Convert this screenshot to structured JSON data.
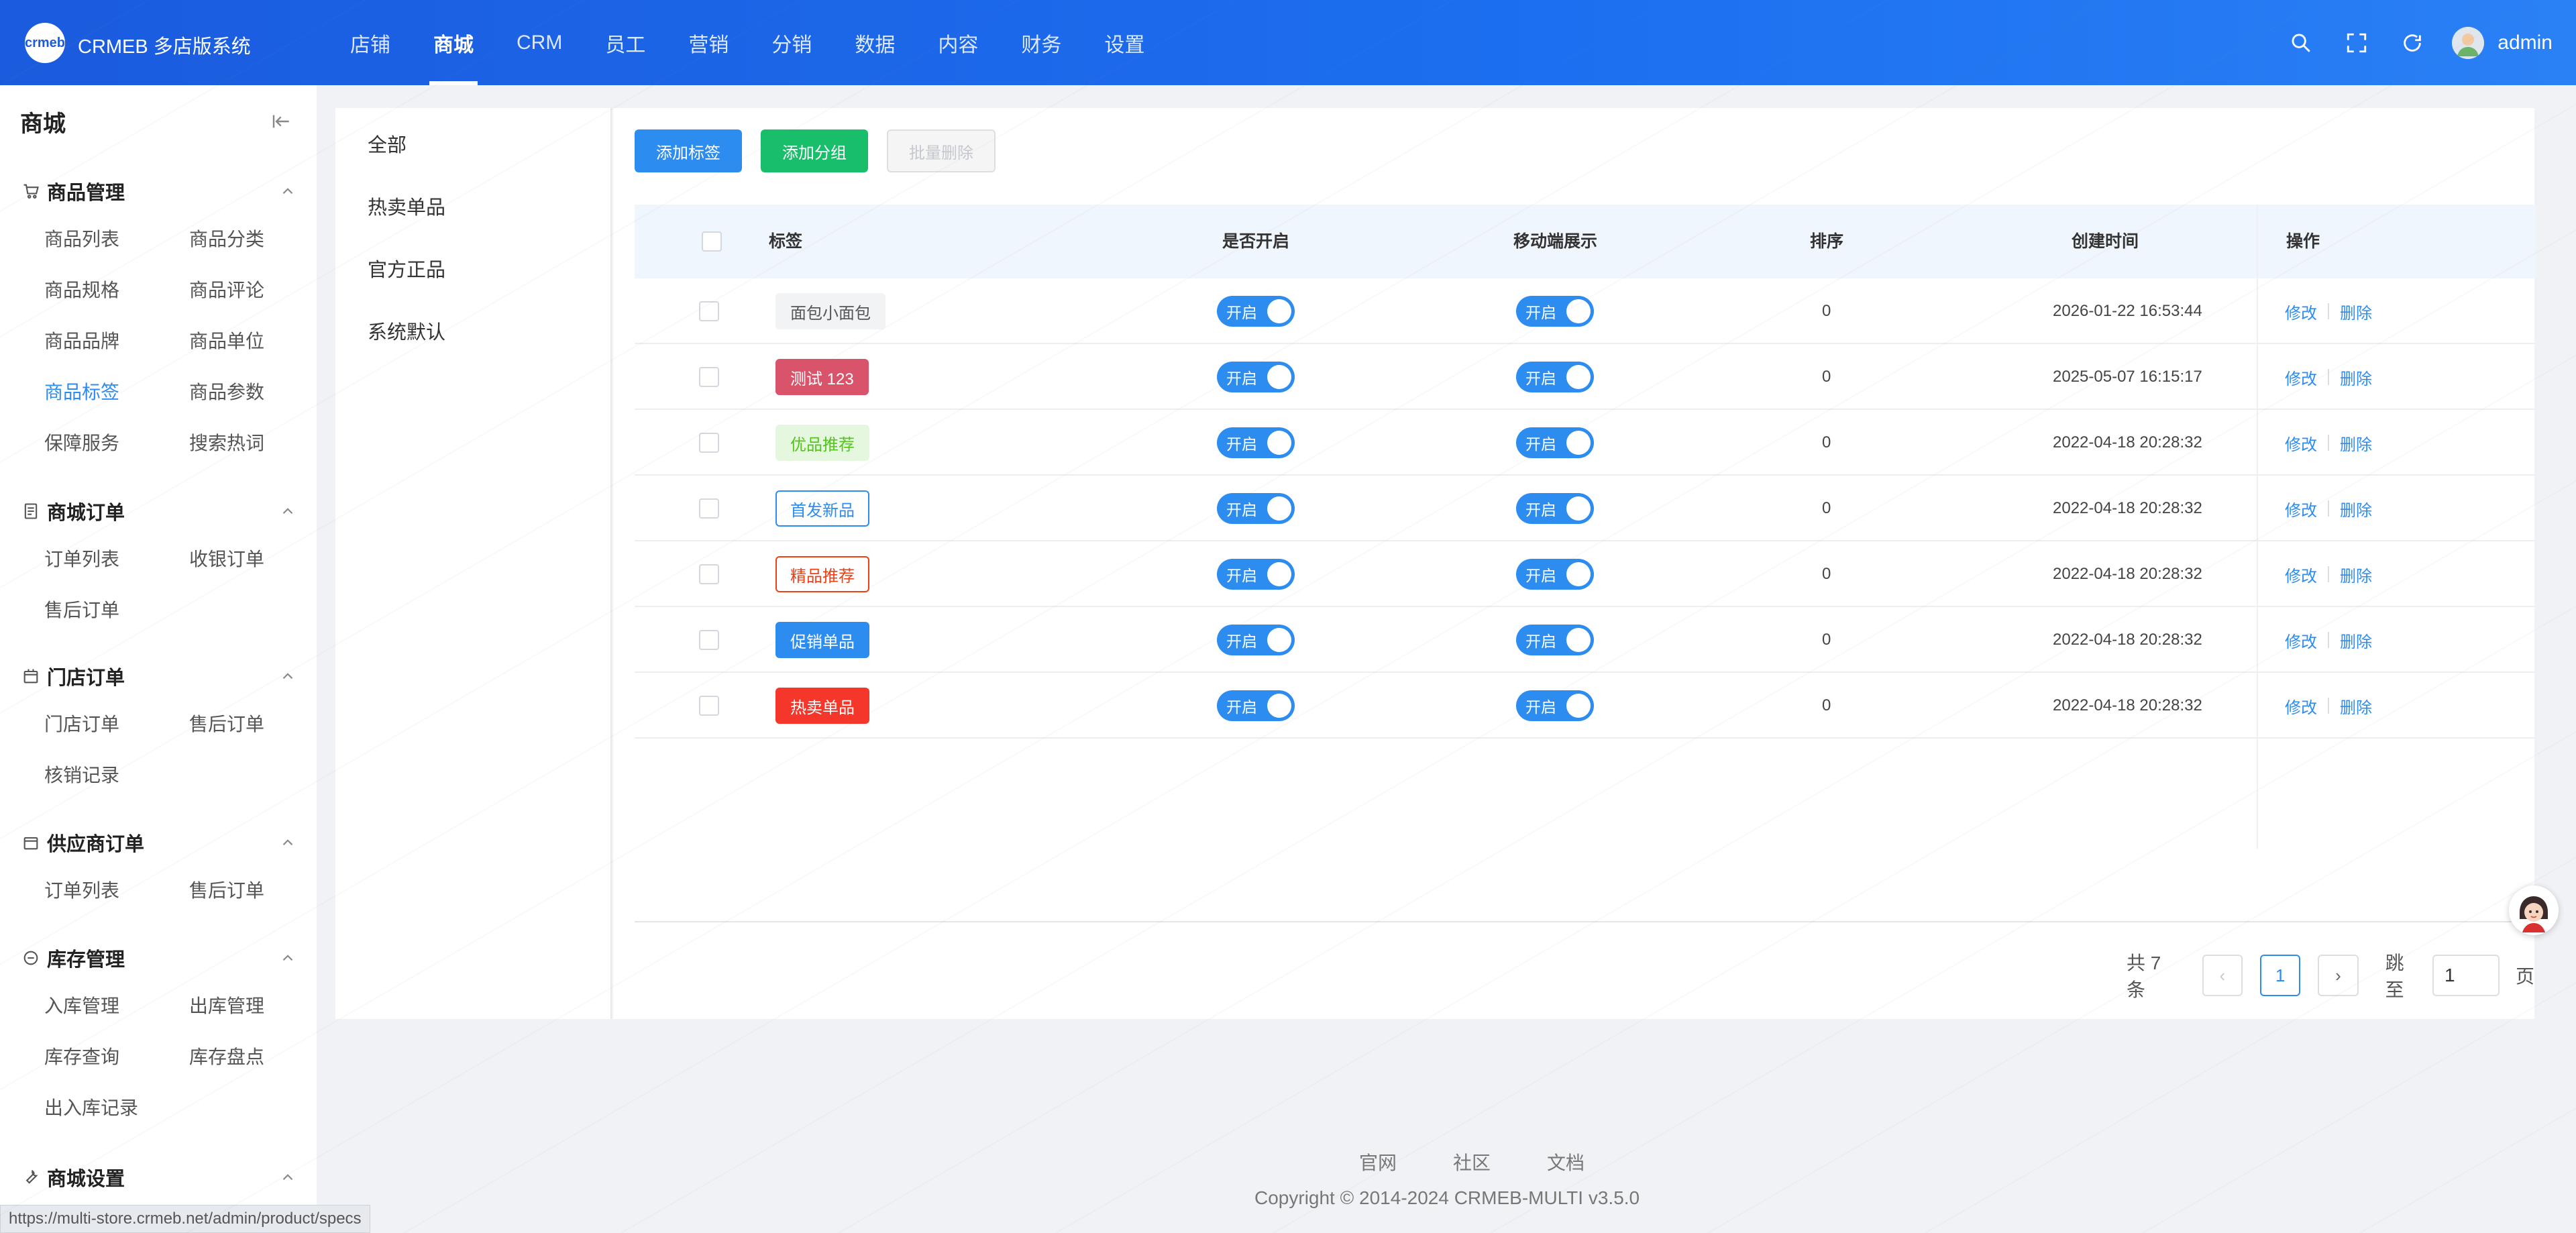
{
  "header": {
    "logo_text": "crmeb",
    "brand": "CRMEB 多店版系统",
    "nav": [
      "店铺",
      "商城",
      "CRM",
      "员工",
      "营销",
      "分销",
      "数据",
      "内容",
      "财务",
      "设置"
    ],
    "active_nav": "商城",
    "user": "admin"
  },
  "sidebar": {
    "title": "商城",
    "groups": [
      {
        "label": "商品管理",
        "icon": "cart-icon",
        "items": [
          "商品列表",
          "商品分类",
          "商品规格",
          "商品评论",
          "商品品牌",
          "商品单位",
          "商品标签",
          "商品参数",
          "保障服务",
          "搜索热词"
        ]
      },
      {
        "label": "商城订单",
        "icon": "order-icon",
        "items": [
          "订单列表",
          "收银订单",
          "售后订单"
        ]
      },
      {
        "label": "门店订单",
        "icon": "store-icon",
        "items": [
          "门店订单",
          "售后订单",
          "核销记录"
        ]
      },
      {
        "label": "供应商订单",
        "icon": "supplier-icon",
        "items": [
          "订单列表",
          "售后订单"
        ]
      },
      {
        "label": "库存管理",
        "icon": "inventory-icon",
        "items": [
          "入库管理",
          "出库管理",
          "库存查询",
          "库存盘点",
          "出入库记录"
        ]
      },
      {
        "label": "商城设置",
        "icon": "wrench-icon",
        "items": []
      }
    ],
    "active_item": "商品标签"
  },
  "categories": [
    "全部",
    "热卖单品",
    "官方正品",
    "系统默认"
  ],
  "toolbar": {
    "add_tag": "添加标签",
    "add_group": "添加分组",
    "batch_delete": "批量删除"
  },
  "table": {
    "columns": [
      "标签",
      "是否开启",
      "移动端展示",
      "排序",
      "创建时间",
      "操作"
    ],
    "rows": [
      {
        "tag": "面包小面包",
        "tag_style": {
          "bg": "#f2f3f5",
          "color": "#555555",
          "border": "#f2f3f5"
        },
        "enabled": "开启",
        "mobile": "开启",
        "sort": "0",
        "created": "2026-01-22 16:53:44",
        "edit": "修改",
        "delete": "删除"
      },
      {
        "tag": "测试 123",
        "tag_style": {
          "bg": "#d9546a",
          "color": "#ffffff",
          "border": "#d9546a"
        },
        "enabled": "开启",
        "mobile": "开启",
        "sort": "0",
        "created": "2025-05-07 16:15:17",
        "edit": "修改",
        "delete": "删除"
      },
      {
        "tag": "优品推荐",
        "tag_style": {
          "bg": "#e6f7e0",
          "color": "#52c41a",
          "border": "#e6f7e0"
        },
        "enabled": "开启",
        "mobile": "开启",
        "sort": "0",
        "created": "2022-04-18 20:28:32",
        "edit": "修改",
        "delete": "删除"
      },
      {
        "tag": "首发新品",
        "tag_style": {
          "bg": "#ffffff",
          "color": "#2d8cf0",
          "border": "#2d8cf0"
        },
        "enabled": "开启",
        "mobile": "开启",
        "sort": "0",
        "created": "2022-04-18 20:28:32",
        "edit": "修改",
        "delete": "删除"
      },
      {
        "tag": "精品推荐",
        "tag_style": {
          "bg": "#ffffff",
          "color": "#ed4014",
          "border": "#ed4014"
        },
        "enabled": "开启",
        "mobile": "开启",
        "sort": "0",
        "created": "2022-04-18 20:28:32",
        "edit": "修改",
        "delete": "删除"
      },
      {
        "tag": "促销单品",
        "tag_style": {
          "bg": "#2d8cf0",
          "color": "#ffffff",
          "border": "#2d8cf0"
        },
        "enabled": "开启",
        "mobile": "开启",
        "sort": "0",
        "created": "2022-04-18 20:28:32",
        "edit": "修改",
        "delete": "删除"
      },
      {
        "tag": "热卖单品",
        "tag_style": {
          "bg": "#f5362a",
          "color": "#ffffff",
          "border": "#f5362a"
        },
        "enabled": "开启",
        "mobile": "开启",
        "sort": "0",
        "created": "2022-04-18 20:28:32",
        "edit": "修改",
        "delete": "删除"
      }
    ]
  },
  "pagination": {
    "total_text": "共 7 条",
    "current": "1",
    "prev": "‹",
    "next": "›",
    "jump_label": "跳至",
    "jump_value": "1",
    "page_unit": "页"
  },
  "footer": {
    "links": [
      "官网",
      "社区",
      "文档"
    ],
    "copyright": "Copyright © 2014-2024 CRMEB-MULTI v3.5.0"
  },
  "status_url": "https://multi-store.crmeb.net/admin/product/specs",
  "colors": {
    "primary": "#2d8cf0",
    "success": "#19be6b",
    "header": "#1c6ff0"
  }
}
